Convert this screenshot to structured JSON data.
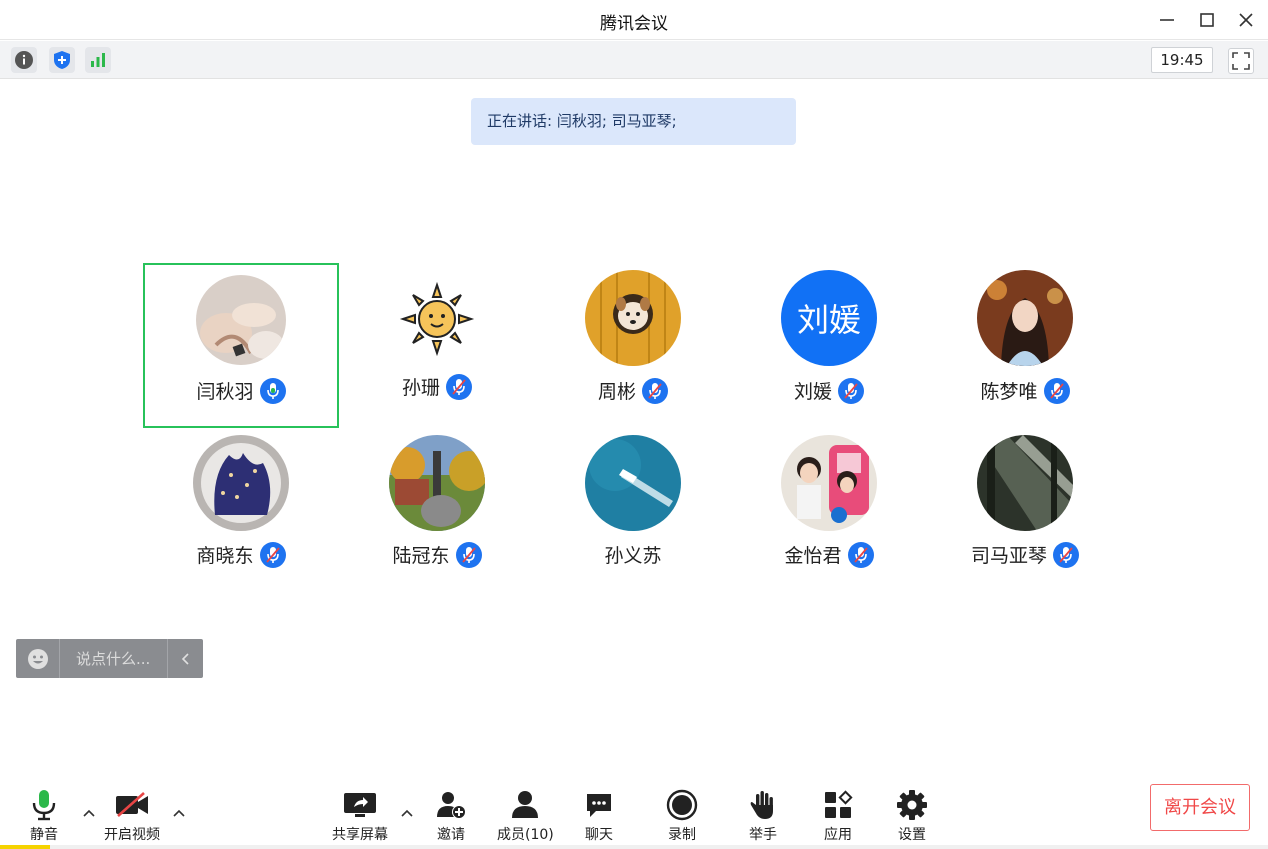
{
  "window": {
    "title": "腾讯会议"
  },
  "infobar": {
    "clock": "19:45"
  },
  "speaking": {
    "text": "正在讲话: 闫秋羽; 司马亚琴;"
  },
  "participants": [
    {
      "name": "闫秋羽",
      "mic": "speaking"
    },
    {
      "name": "孙珊",
      "mic": "muted"
    },
    {
      "name": "周彬",
      "mic": "muted"
    },
    {
      "name": "刘媛",
      "mic": "muted",
      "avatar_text": "刘媛"
    },
    {
      "name": "陈梦唯",
      "mic": "muted"
    },
    {
      "name": "商晓东",
      "mic": "muted"
    },
    {
      "name": "陆冠东",
      "mic": "muted"
    },
    {
      "name": "孙义苏",
      "mic": "none"
    },
    {
      "name": "金怡君",
      "mic": "muted"
    },
    {
      "name": "司马亚琴",
      "mic": "muted"
    }
  ],
  "chat": {
    "placeholder": "说点什么..."
  },
  "toolbar": {
    "mute": "静音",
    "video": "开启视频",
    "share": "共享屏幕",
    "invite": "邀请",
    "members": "成员(10)",
    "chat": "聊天",
    "record": "录制",
    "raise_hand": "举手",
    "apps": "应用",
    "settings": "设置",
    "leave": "离开会议"
  },
  "colors": {
    "accent": "#1e73f0",
    "active_border": "#27c25a",
    "leave": "#f04848",
    "mic_active": "#2bb84a"
  }
}
